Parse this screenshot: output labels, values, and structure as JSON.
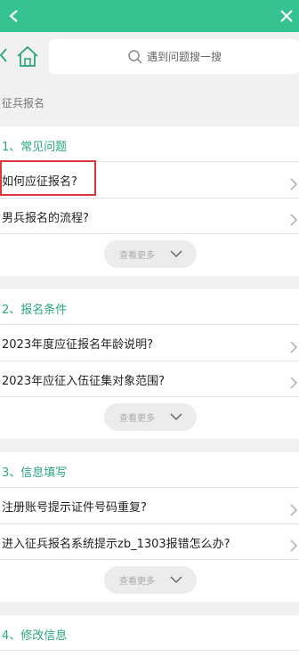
{
  "topbar": {
    "back_icon": "chevron-left-icon",
    "close_icon": "close-icon",
    "color": "#35c290"
  },
  "search": {
    "placeholder": "遇到问题搜一搜"
  },
  "breadcrumb": "征兵报名",
  "accent": "#2aa582",
  "sections": [
    {
      "title": "1、常见问题",
      "items": [
        "如何应征报名?",
        "男兵报名的流程?"
      ],
      "more": "查看更多"
    },
    {
      "title": "2、报名条件",
      "items": [
        "2023年度应征报名年龄说明?",
        "2023年应征入伍征集对象范围?"
      ],
      "more": "查看更多"
    },
    {
      "title": "3、信息填写",
      "items": [
        "注册账号提示证件号码重复?",
        "进入征兵报名系统提示zb_1303报错怎么办?"
      ],
      "more": "查看更多"
    },
    {
      "title": "4、修改信息",
      "items": []
    }
  ]
}
